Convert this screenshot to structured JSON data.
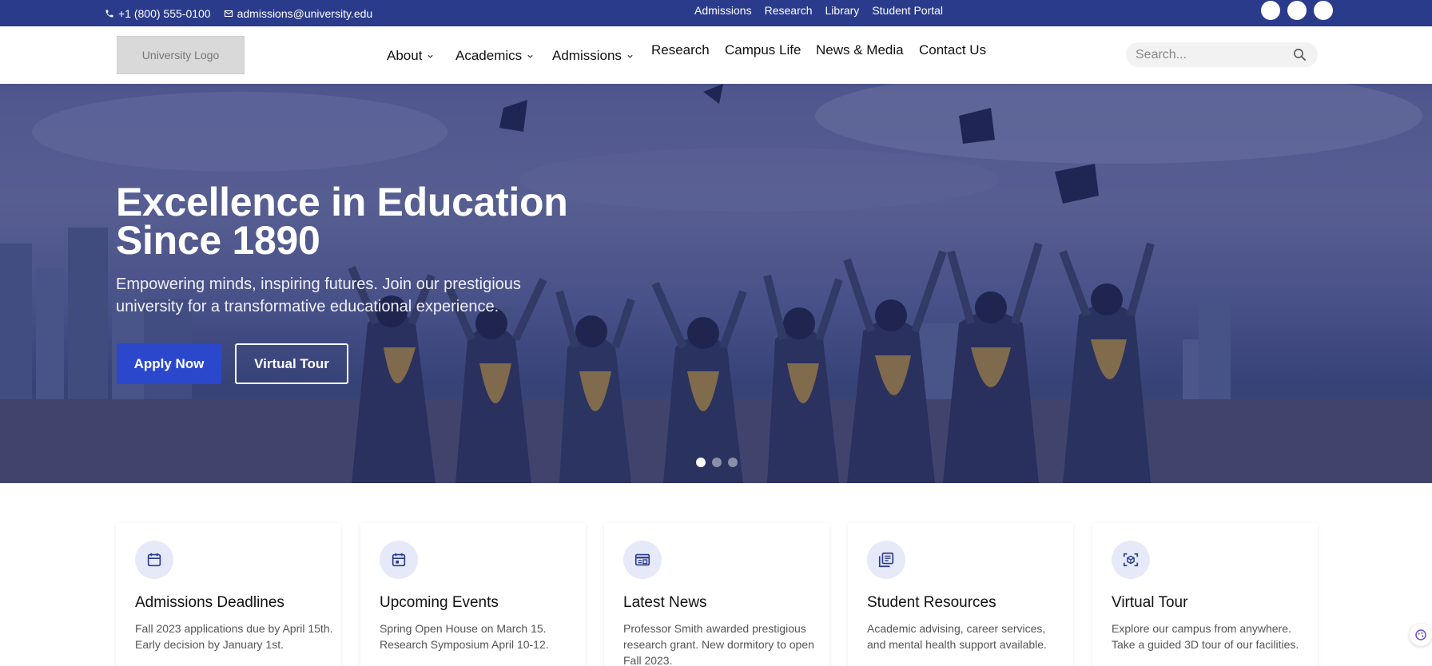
{
  "topbar": {
    "phone": "+1 (800) 555-0100",
    "email": "admissions@university.edu",
    "links": [
      "Admissions",
      "Research",
      "Library",
      "Student Portal"
    ]
  },
  "header": {
    "logo_text": "University Logo",
    "nav": {
      "about": "About",
      "academics": "Academics",
      "admissions": "Admissions",
      "research": "Research",
      "campus_life": "Campus Life",
      "news_media": "News & Media",
      "contact": "Contact Us"
    },
    "search_placeholder": "Search..."
  },
  "hero": {
    "title_line1": "Excellence in Education",
    "title_line2": "Since 1890",
    "subtitle": "Empowering minds, inspiring futures. Join our prestigious university for a transformative educational experience.",
    "apply_label": "Apply Now",
    "tour_label": "Virtual Tour",
    "slides": 3,
    "active_slide": 1
  },
  "cards": [
    {
      "icon": "calendar-icon",
      "title": "Admissions Deadlines",
      "text": "Fall 2023 applications due by April 15th. Early decision by January 1st."
    },
    {
      "icon": "calendar-event-icon",
      "title": "Upcoming Events",
      "text": "Spring Open House on March 15. Research Symposium April 10-12."
    },
    {
      "icon": "newspaper-icon",
      "title": "Latest News",
      "text": "Professor Smith awarded prestigious research grant. New dormitory to open Fall 2023."
    },
    {
      "icon": "library-icon",
      "title": "Student Resources",
      "text": "Academic advising, career services, and mental health support available."
    },
    {
      "icon": "360-view-icon",
      "title": "Virtual Tour",
      "text": "Explore our campus from anywhere. Take a guided 3D tour of our facilities."
    }
  ],
  "colors": {
    "topbar": "#2a3b8c",
    "primary_button": "#2b48cc",
    "icon_circle": "#e6e9f8",
    "icon": "#2a3b8c"
  }
}
